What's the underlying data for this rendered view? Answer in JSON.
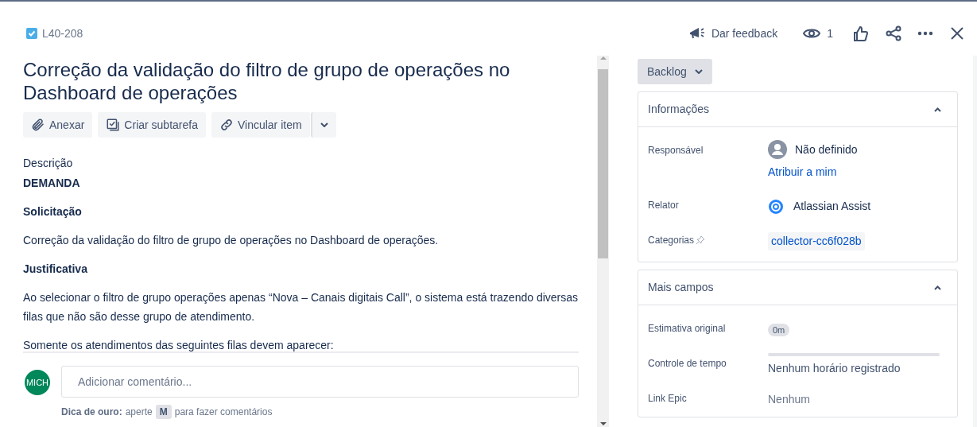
{
  "issue_key": "L40-208",
  "header_actions": {
    "feedback": "Dar feedback",
    "watchers": "1"
  },
  "title": "Correção da validação do filtro de grupo de operações no Dashboard de operações",
  "toolbar": [
    {
      "kind": "attach",
      "label": "Anexar"
    },
    {
      "kind": "subtask",
      "label": "Criar subtarefa"
    },
    {
      "kind": "link",
      "label": "Vincular item"
    }
  ],
  "description": {
    "label": "Descrição",
    "blocks": [
      {
        "kind": "heading",
        "text": "DEMANDA"
      },
      {
        "kind": "heading",
        "text": "Solicitação"
      },
      {
        "kind": "paragraph",
        "text": "Correção da validação do filtro de grupo de operações no Dashboard de operações."
      },
      {
        "kind": "heading",
        "text": "Justificativa"
      },
      {
        "kind": "paragraph",
        "text": "Ao selecionar o filtro de grupo operações apenas “Nova – Canais digitais Call”, o sistema está trazendo diversas filas que não são desse grupo de atendimento."
      },
      {
        "kind": "paragraph",
        "text": "Somente os atendimentos das seguintes filas devem aparecer:"
      }
    ]
  },
  "comment": {
    "avatar": "MICH",
    "placeholder": "Adicionar comentário...",
    "tip_bold": "Dica de ouro:",
    "tip_before": "aperte",
    "tip_key": "M",
    "tip_after": "para fazer comentários"
  },
  "status": "Backlog",
  "panels": [
    {
      "title": "Informações",
      "expanded": true,
      "fields": [
        {
          "label": "Responsável",
          "kind": "user",
          "value": "Não definido",
          "link": "Atribuir a mim"
        },
        {
          "label": "Relator",
          "kind": "assist",
          "value": "Atlassian Assist"
        },
        {
          "label": "Categorias",
          "kind": "tag",
          "pinnable": true,
          "value": "collector-cc6f028b"
        }
      ]
    },
    {
      "title": "Mais campos",
      "expanded": true,
      "fields": [
        {
          "label": "Estimativa original",
          "kind": "pill",
          "value": "0m"
        },
        {
          "label": "Controle de tempo",
          "kind": "timer",
          "level": 0,
          "value": "Nenhum horário registrado"
        },
        {
          "label": "Link Epic",
          "kind": "text",
          "value": "Nenhum"
        }
      ]
    }
  ]
}
